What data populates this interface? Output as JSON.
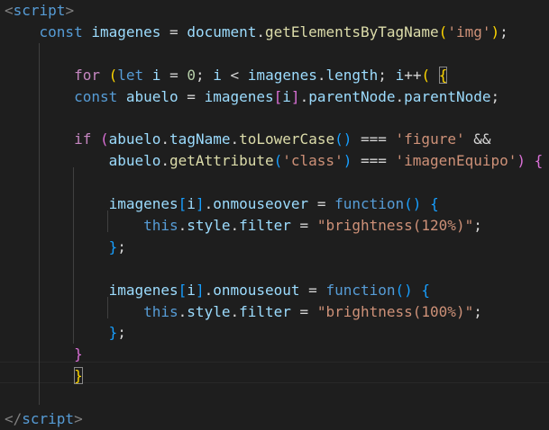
{
  "editor": {
    "lines": [
      {
        "id": "l1",
        "tokens": [
          [
            "tag",
            "<"
          ],
          [
            "tagname",
            "script"
          ],
          [
            "tag",
            ">"
          ]
        ]
      },
      {
        "id": "l2",
        "tokens": [
          [
            "op",
            "    "
          ],
          [
            "kw",
            "const"
          ],
          [
            "op",
            " "
          ],
          [
            "var",
            "imagenes"
          ],
          [
            "op",
            " = "
          ],
          [
            "var",
            "document"
          ],
          [
            "op",
            "."
          ],
          [
            "fn",
            "getElementsByTagName"
          ],
          [
            "b1",
            "("
          ],
          [
            "str",
            "'img'"
          ],
          [
            "b1",
            ")"
          ],
          [
            "op",
            ";"
          ]
        ]
      },
      {
        "id": "l3",
        "tokens": []
      },
      {
        "id": "l4",
        "tokens": [
          [
            "op",
            "        "
          ],
          [
            "ctrl",
            "for"
          ],
          [
            "op",
            " "
          ],
          [
            "b1",
            "("
          ],
          [
            "kw",
            "let"
          ],
          [
            "op",
            " "
          ],
          [
            "var",
            "i"
          ],
          [
            "op",
            " = "
          ],
          [
            "num",
            "0"
          ],
          [
            "op",
            "; "
          ],
          [
            "var",
            "i"
          ],
          [
            "op",
            " < "
          ],
          [
            "var",
            "imagenes"
          ],
          [
            "op",
            "."
          ],
          [
            "var",
            "length"
          ],
          [
            "op",
            "; "
          ],
          [
            "var",
            "i"
          ],
          [
            "op",
            "++"
          ],
          [
            "b1",
            "("
          ],
          [
            "op",
            " "
          ],
          [
            "b1m",
            "{"
          ]
        ]
      },
      {
        "id": "l5",
        "tokens": [
          [
            "op",
            "        "
          ],
          [
            "kw",
            "const"
          ],
          [
            "op",
            " "
          ],
          [
            "var",
            "abuelo"
          ],
          [
            "op",
            " = "
          ],
          [
            "var",
            "imagenes"
          ],
          [
            "b2",
            "["
          ],
          [
            "var",
            "i"
          ],
          [
            "b2",
            "]"
          ],
          [
            "op",
            "."
          ],
          [
            "var",
            "parentNode"
          ],
          [
            "op",
            "."
          ],
          [
            "var",
            "parentNode"
          ],
          [
            "op",
            ";"
          ]
        ]
      },
      {
        "id": "l6",
        "tokens": []
      },
      {
        "id": "l7",
        "tokens": [
          [
            "op",
            "        "
          ],
          [
            "ctrl",
            "if"
          ],
          [
            "op",
            " "
          ],
          [
            "b2",
            "("
          ],
          [
            "var",
            "abuelo"
          ],
          [
            "op",
            "."
          ],
          [
            "var",
            "tagName"
          ],
          [
            "op",
            "."
          ],
          [
            "fn",
            "toLowerCase"
          ],
          [
            "b3",
            "()"
          ],
          [
            "op",
            " === "
          ],
          [
            "str",
            "'figure'"
          ],
          [
            "op",
            " &&"
          ]
        ]
      },
      {
        "id": "l8",
        "tokens": [
          [
            "op",
            "            "
          ],
          [
            "var",
            "abuelo"
          ],
          [
            "op",
            "."
          ],
          [
            "fn",
            "getAttribute"
          ],
          [
            "b3",
            "("
          ],
          [
            "str",
            "'class'"
          ],
          [
            "b3",
            ")"
          ],
          [
            "op",
            " === "
          ],
          [
            "str",
            "'imagenEquipo'"
          ],
          [
            "b2",
            ")"
          ],
          [
            "op",
            " "
          ],
          [
            "b2",
            "{"
          ]
        ]
      },
      {
        "id": "l9",
        "tokens": []
      },
      {
        "id": "l10",
        "tokens": [
          [
            "op",
            "            "
          ],
          [
            "var",
            "imagenes"
          ],
          [
            "b3",
            "["
          ],
          [
            "var",
            "i"
          ],
          [
            "b3",
            "]"
          ],
          [
            "op",
            "."
          ],
          [
            "var",
            "onmouseover"
          ],
          [
            "op",
            " = "
          ],
          [
            "kw",
            "function"
          ],
          [
            "b3",
            "()"
          ],
          [
            "op",
            " "
          ],
          [
            "b3",
            "{"
          ]
        ]
      },
      {
        "id": "l11",
        "tokens": [
          [
            "op",
            "                "
          ],
          [
            "kw",
            "this"
          ],
          [
            "op",
            "."
          ],
          [
            "var",
            "style"
          ],
          [
            "op",
            "."
          ],
          [
            "var",
            "filter"
          ],
          [
            "op",
            " = "
          ],
          [
            "str",
            "\"brightness(120%)\""
          ],
          [
            "op",
            ";"
          ]
        ]
      },
      {
        "id": "l12",
        "tokens": [
          [
            "op",
            "            "
          ],
          [
            "b3",
            "}"
          ],
          [
            "op",
            ";"
          ]
        ]
      },
      {
        "id": "l13",
        "tokens": []
      },
      {
        "id": "l14",
        "tokens": [
          [
            "op",
            "            "
          ],
          [
            "var",
            "imagenes"
          ],
          [
            "b3",
            "["
          ],
          [
            "var",
            "i"
          ],
          [
            "b3",
            "]"
          ],
          [
            "op",
            "."
          ],
          [
            "var",
            "onmouseout"
          ],
          [
            "op",
            " = "
          ],
          [
            "kw",
            "function"
          ],
          [
            "b3",
            "()"
          ],
          [
            "op",
            " "
          ],
          [
            "b3",
            "{"
          ]
        ]
      },
      {
        "id": "l15",
        "tokens": [
          [
            "op",
            "                "
          ],
          [
            "kw",
            "this"
          ],
          [
            "op",
            "."
          ],
          [
            "var",
            "style"
          ],
          [
            "op",
            "."
          ],
          [
            "var",
            "filter"
          ],
          [
            "op",
            " = "
          ],
          [
            "str",
            "\"brightness(100%)\""
          ],
          [
            "op",
            ";"
          ]
        ]
      },
      {
        "id": "l16",
        "tokens": [
          [
            "op",
            "            "
          ],
          [
            "b3",
            "}"
          ],
          [
            "op",
            ";"
          ]
        ]
      },
      {
        "id": "l17",
        "tokens": [
          [
            "op",
            "        "
          ],
          [
            "b2",
            "}"
          ]
        ]
      },
      {
        "id": "l18",
        "tokens": [
          [
            "op",
            "        "
          ],
          [
            "b1m",
            "}"
          ]
        ]
      },
      {
        "id": "l19",
        "tokens": []
      },
      {
        "id": "l20",
        "tokens": [
          [
            "tag",
            "</"
          ],
          [
            "tagname",
            "script"
          ],
          [
            "tag",
            ">"
          ]
        ]
      }
    ]
  },
  "colors": {
    "background": "#1e1e1e",
    "keyword": "#569cd6",
    "control": "#c586c0",
    "variable": "#9cdcfe",
    "function": "#dcdcaa",
    "string": "#ce9178",
    "number": "#b5cea8",
    "bracket_gold": "#ffd700",
    "bracket_orchid": "#da70d6",
    "bracket_blue": "#179fff"
  }
}
